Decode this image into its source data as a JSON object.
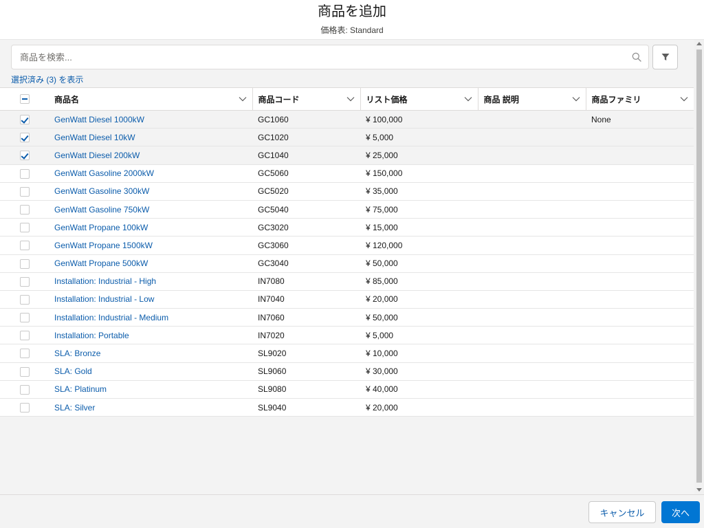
{
  "header": {
    "title": "商品を追加",
    "subtitle": "価格表: Standard"
  },
  "search": {
    "placeholder": "商品を検索...",
    "value": ""
  },
  "show_selected_label": "選択済み (3) を表示",
  "table": {
    "columns": [
      "商品名",
      "商品コード",
      "リスト価格",
      "商品 説明",
      "商品ファミリ"
    ],
    "rows": [
      {
        "name": "GenWatt Diesel 1000kW",
        "code": "GC1060",
        "price": "¥ 100,000",
        "description": "",
        "family": "None",
        "selected": true
      },
      {
        "name": "GenWatt Diesel 10kW",
        "code": "GC1020",
        "price": "¥ 5,000",
        "description": "",
        "family": "",
        "selected": true
      },
      {
        "name": "GenWatt Diesel 200kW",
        "code": "GC1040",
        "price": "¥ 25,000",
        "description": "",
        "family": "",
        "selected": true
      },
      {
        "name": "GenWatt Gasoline 2000kW",
        "code": "GC5060",
        "price": "¥ 150,000",
        "description": "",
        "family": "",
        "selected": false
      },
      {
        "name": "GenWatt Gasoline 300kW",
        "code": "GC5020",
        "price": "¥ 35,000",
        "description": "",
        "family": "",
        "selected": false
      },
      {
        "name": "GenWatt Gasoline 750kW",
        "code": "GC5040",
        "price": "¥ 75,000",
        "description": "",
        "family": "",
        "selected": false
      },
      {
        "name": "GenWatt Propane 100kW",
        "code": "GC3020",
        "price": "¥ 15,000",
        "description": "",
        "family": "",
        "selected": false
      },
      {
        "name": "GenWatt Propane 1500kW",
        "code": "GC3060",
        "price": "¥ 120,000",
        "description": "",
        "family": "",
        "selected": false
      },
      {
        "name": "GenWatt Propane 500kW",
        "code": "GC3040",
        "price": "¥ 50,000",
        "description": "",
        "family": "",
        "selected": false
      },
      {
        "name": "Installation: Industrial - High",
        "code": "IN7080",
        "price": "¥ 85,000",
        "description": "",
        "family": "",
        "selected": false
      },
      {
        "name": "Installation: Industrial - Low",
        "code": "IN7040",
        "price": "¥ 20,000",
        "description": "",
        "family": "",
        "selected": false
      },
      {
        "name": "Installation: Industrial - Medium",
        "code": "IN7060",
        "price": "¥ 50,000",
        "description": "",
        "family": "",
        "selected": false
      },
      {
        "name": "Installation: Portable",
        "code": "IN7020",
        "price": "¥ 5,000",
        "description": "",
        "family": "",
        "selected": false
      },
      {
        "name": "SLA: Bronze",
        "code": "SL9020",
        "price": "¥ 10,000",
        "description": "",
        "family": "",
        "selected": false
      },
      {
        "name": "SLA: Gold",
        "code": "SL9060",
        "price": "¥ 30,000",
        "description": "",
        "family": "",
        "selected": false
      },
      {
        "name": "SLA: Platinum",
        "code": "SL9080",
        "price": "¥ 40,000",
        "description": "",
        "family": "",
        "selected": false
      },
      {
        "name": "SLA: Silver",
        "code": "SL9040",
        "price": "¥ 20,000",
        "description": "",
        "family": "",
        "selected": false
      }
    ]
  },
  "footer": {
    "cancel_label": "キャンセル",
    "next_label": "次へ"
  },
  "colors": {
    "link": "#0b5cab",
    "brand": "#0176d3",
    "selected_row": "#f3f3f3"
  },
  "icons": {
    "search": "search-icon",
    "filter": "filter-icon",
    "column_menu": "chevron-down-icon"
  }
}
